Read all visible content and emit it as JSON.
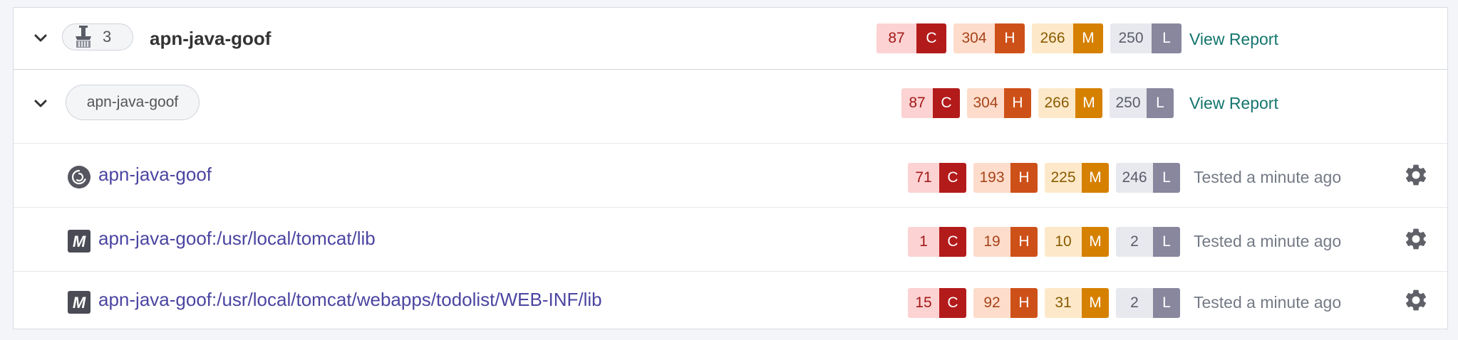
{
  "group": {
    "count": "3",
    "title": "apn-java-goof",
    "view_report_label": "View Report",
    "issues": [
      {
        "count": "87",
        "letter": "C"
      },
      {
        "count": "304",
        "letter": "H"
      },
      {
        "count": "266",
        "letter": "M"
      },
      {
        "count": "250",
        "letter": "L"
      }
    ]
  },
  "target": {
    "tag": "apn-java-goof",
    "view_report_label": "View Report",
    "issues": [
      {
        "count": "87",
        "letter": "C"
      },
      {
        "count": "304",
        "letter": "H"
      },
      {
        "count": "266",
        "letter": "M"
      },
      {
        "count": "250",
        "letter": "L"
      }
    ]
  },
  "projects": [
    {
      "icon": "debian-icon",
      "name": "apn-java-goof",
      "tested": "Tested a minute ago",
      "issues": [
        {
          "count": "71",
          "letter": "C"
        },
        {
          "count": "193",
          "letter": "H"
        },
        {
          "count": "225",
          "letter": "M"
        },
        {
          "count": "246",
          "letter": "L"
        }
      ]
    },
    {
      "icon": "maven-icon",
      "name": "apn-java-goof:/usr/local/tomcat/lib",
      "tested": "Tested a minute ago",
      "issues": [
        {
          "count": "1",
          "letter": "C"
        },
        {
          "count": "19",
          "letter": "H"
        },
        {
          "count": "10",
          "letter": "M"
        },
        {
          "count": "2",
          "letter": "L"
        }
      ]
    },
    {
      "icon": "maven-icon",
      "name": "apn-java-goof:/usr/local/tomcat/webapps/todolist/WEB-INF/lib",
      "tested": "Tested a minute ago",
      "issues": [
        {
          "count": "15",
          "letter": "C"
        },
        {
          "count": "92",
          "letter": "H"
        },
        {
          "count": "31",
          "letter": "M"
        },
        {
          "count": "2",
          "letter": "L"
        }
      ]
    }
  ],
  "colors": {
    "critical": "#b31b1b",
    "high": "#ce5019",
    "medium": "#d68000",
    "low": "#88879e",
    "link": "#4b45a1",
    "view_report": "#13756e"
  }
}
